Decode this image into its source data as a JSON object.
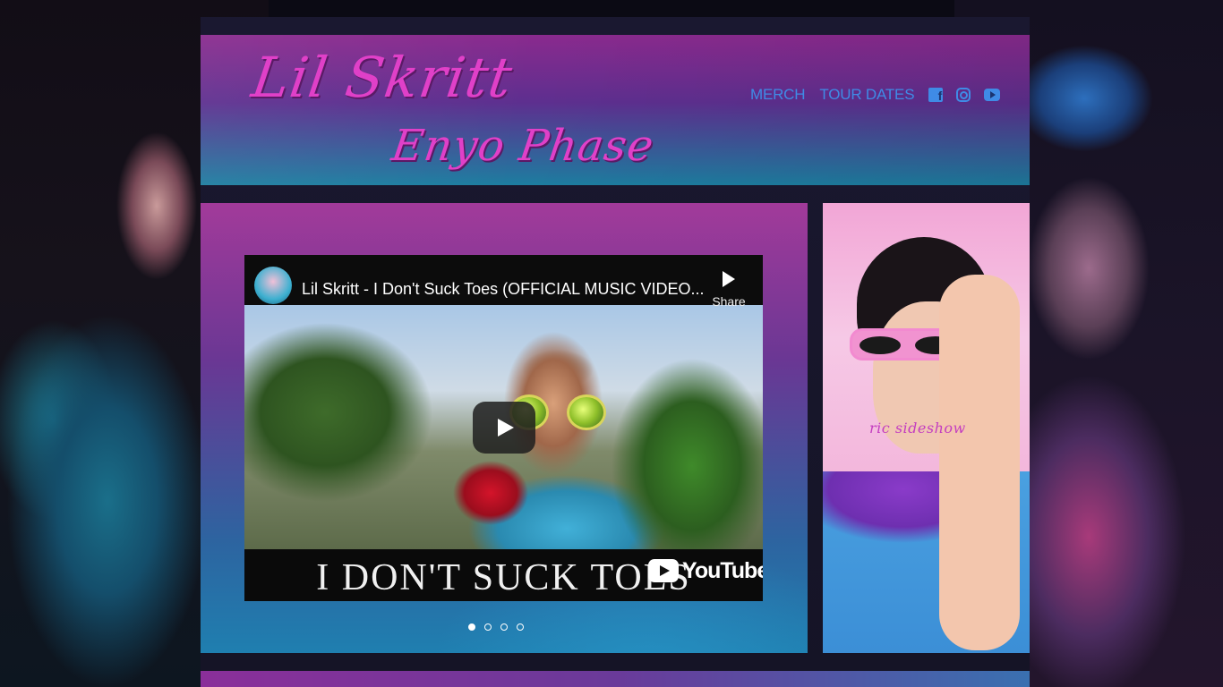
{
  "site": {
    "logo_line1": "Lil Skritt",
    "logo_line2": "Enyo Phase"
  },
  "nav": {
    "items": [
      {
        "label": "MERCH"
      },
      {
        "label": "TOUR DATES"
      }
    ],
    "social_icons": [
      "facebook-icon",
      "instagram-icon",
      "youtube-icon"
    ]
  },
  "video": {
    "title": "Lil Skritt - I Don't Suck Toes (OFFICIAL MUSIC VIDEO...",
    "share_label": "Share",
    "caption": "I DON'T SUCK TOES",
    "platform_label": "YouTube"
  },
  "carousel": {
    "slide_count": 4,
    "active_index": 0
  },
  "side_art": {
    "caption": "ric sideshow"
  },
  "colors": {
    "nav_link": "#3f8be6",
    "logo": "#e040c8",
    "header_top": "#8a2a8e",
    "header_bottom": "#1d7da0"
  }
}
